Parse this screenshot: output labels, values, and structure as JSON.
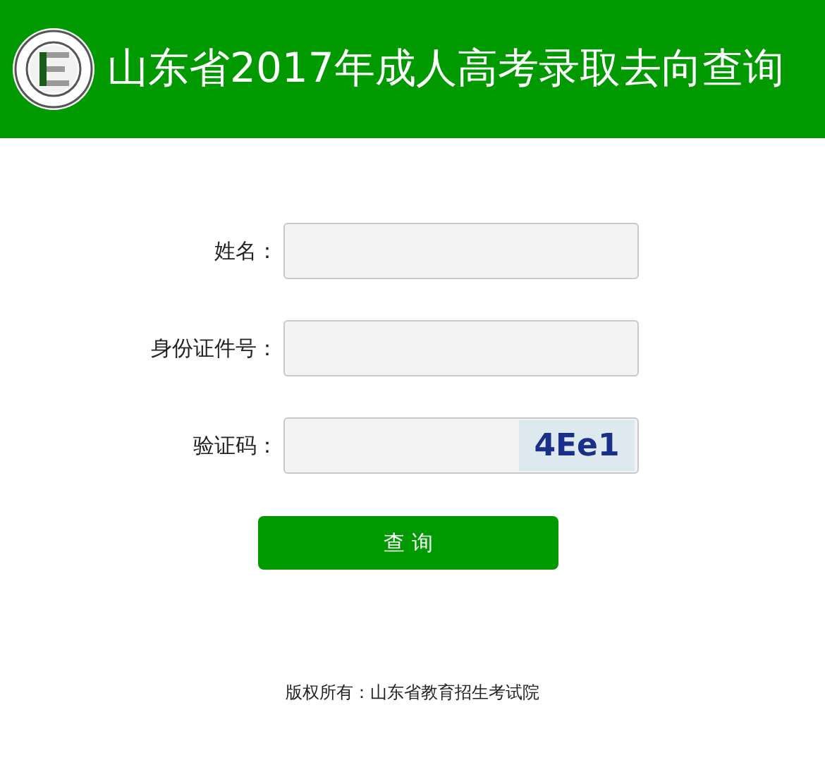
{
  "header": {
    "title": "山东省2017年成人高考录取去向查询"
  },
  "form": {
    "fields": [
      {
        "label": "姓名：",
        "kind": "text"
      },
      {
        "label": "身份证件号：",
        "kind": "text"
      },
      {
        "label": "验证码：",
        "kind": "captcha",
        "captcha": "4Ee1"
      }
    ],
    "submit": "查 询"
  },
  "footer": "版权所有：山东省教育招生考试院"
}
